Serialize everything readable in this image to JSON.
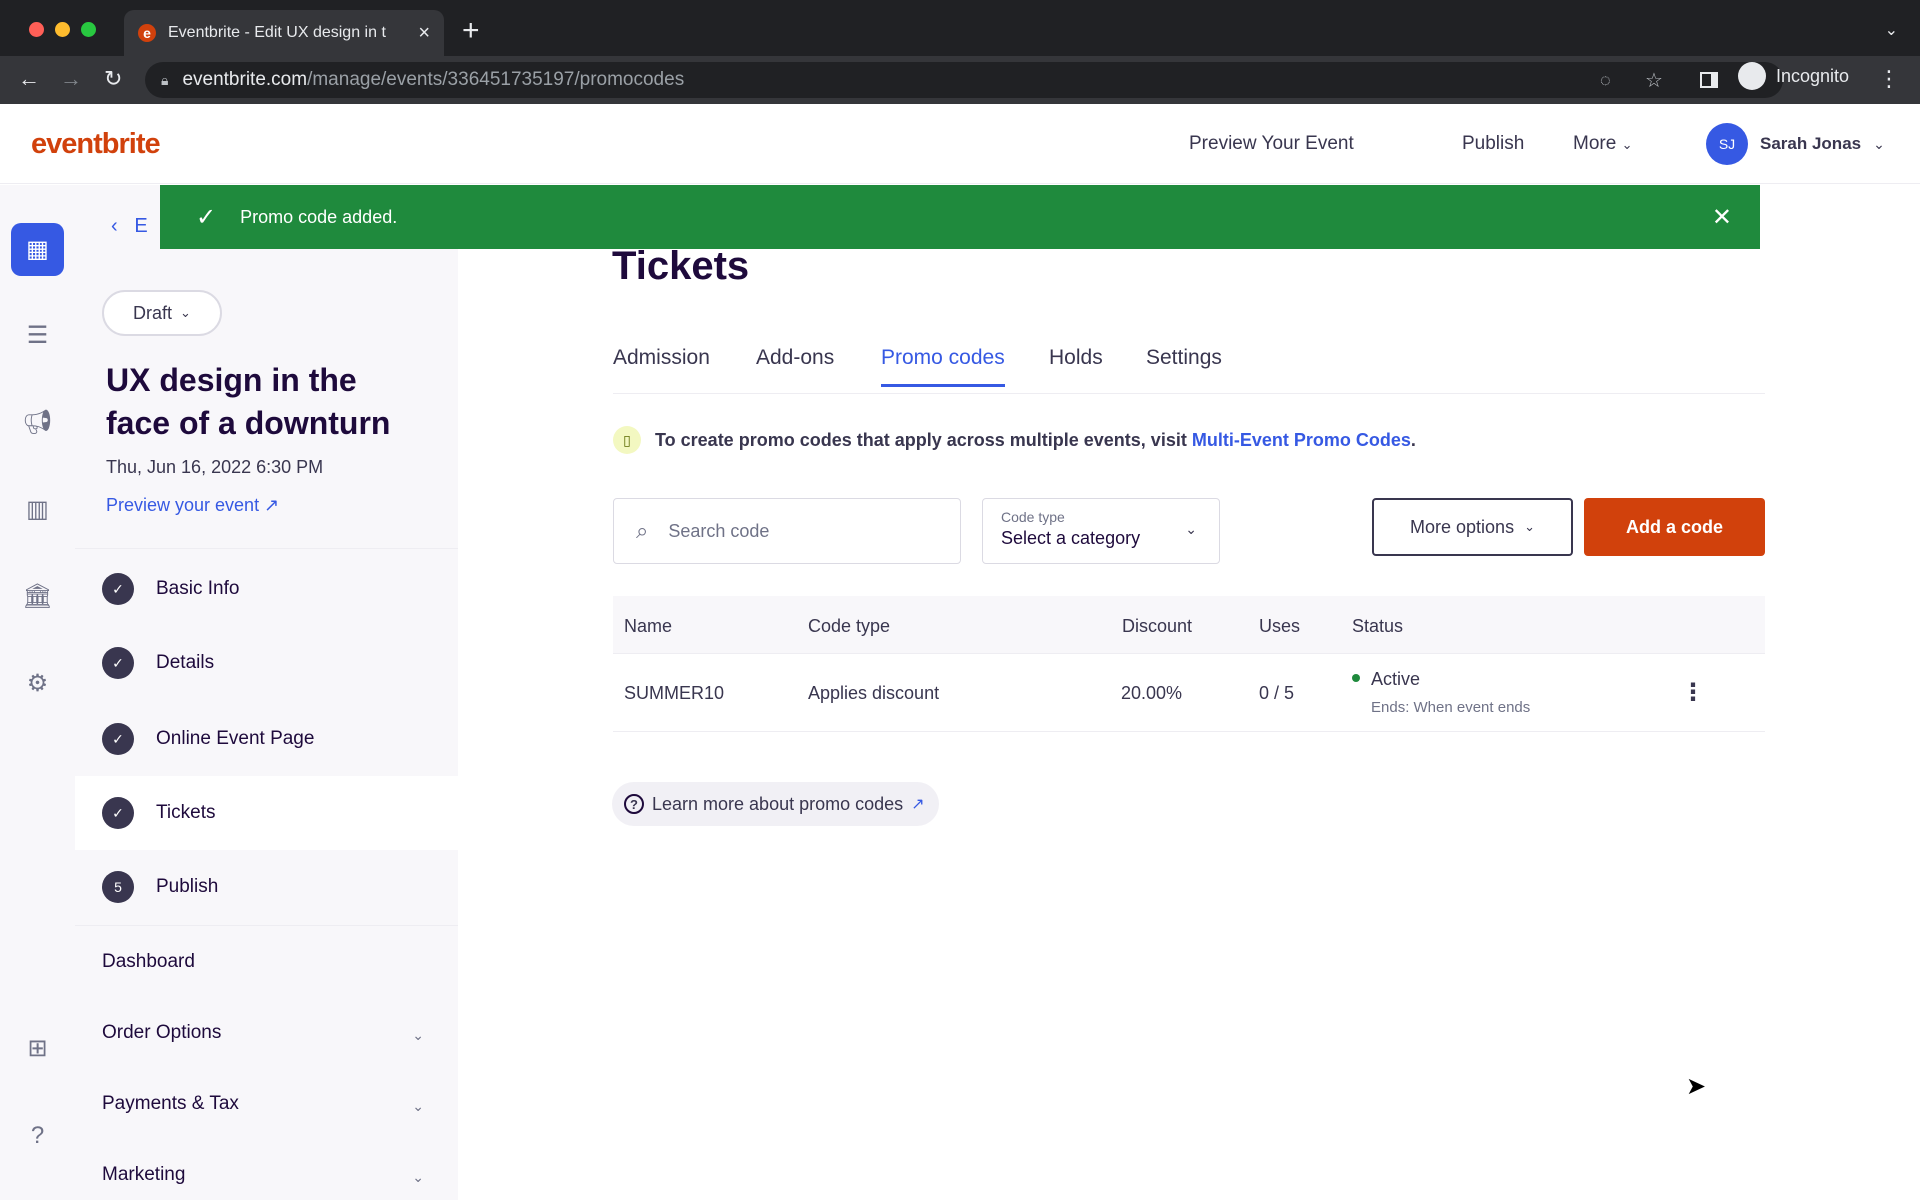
{
  "browser": {
    "tab_title": "Eventbrite - Edit UX design in t",
    "url_host": "eventbrite.com",
    "url_path": "/manage/events/336451735197/promocodes",
    "incognito_label": "Incognito"
  },
  "header": {
    "logo": "eventbrite",
    "preview_label": "Preview Your Event",
    "publish_label": "Publish",
    "more_label": "More",
    "user_initials": "SJ",
    "user_name": "Sarah Jonas"
  },
  "toast": {
    "message": "Promo code added."
  },
  "sidebar": {
    "back_label": "E",
    "status": "Draft",
    "event_title": "UX design in the face of a downturn",
    "event_date": "Thu, Jun 16, 2022 6:30 PM",
    "preview_link": "Preview your event",
    "steps": [
      {
        "label": "Basic Info",
        "marker": "✓"
      },
      {
        "label": "Details",
        "marker": "✓"
      },
      {
        "label": "Online Event Page",
        "marker": "✓"
      },
      {
        "label": "Tickets",
        "marker": "✓"
      },
      {
        "label": "Publish",
        "marker": "5"
      }
    ],
    "sections": [
      {
        "label": "Dashboard"
      },
      {
        "label": "Order Options"
      },
      {
        "label": "Payments & Tax"
      },
      {
        "label": "Marketing"
      }
    ]
  },
  "main": {
    "title": "Tickets",
    "tabs": [
      "Admission",
      "Add-ons",
      "Promo codes",
      "Holds",
      "Settings"
    ],
    "active_tab": "Promo codes",
    "info_text": "To create promo codes that apply across multiple events, visit",
    "info_link": "Multi-Event Promo Codes",
    "info_end": ".",
    "search_placeholder": "Search code",
    "code_type_label": "Code type",
    "code_type_value": "Select a category",
    "more_options_label": "More options",
    "add_code_label": "Add a code",
    "table": {
      "columns": [
        "Name",
        "Code type",
        "Discount",
        "Uses",
        "Status"
      ],
      "rows": [
        {
          "name": "SUMMER10",
          "code_type": "Applies discount",
          "discount": "20.00%",
          "uses": "0 / 5",
          "status": "Active",
          "status_sub": "Ends: When event ends"
        }
      ]
    },
    "learn_more": "Learn more about promo codes"
  },
  "icons": {
    "search": "search-icon",
    "check": "check-icon",
    "close": "close-icon",
    "chevron": "chevron-down-icon"
  },
  "colors": {
    "brand": "#d1410c",
    "accent": "#3659e3",
    "success": "#1f8a3d"
  }
}
